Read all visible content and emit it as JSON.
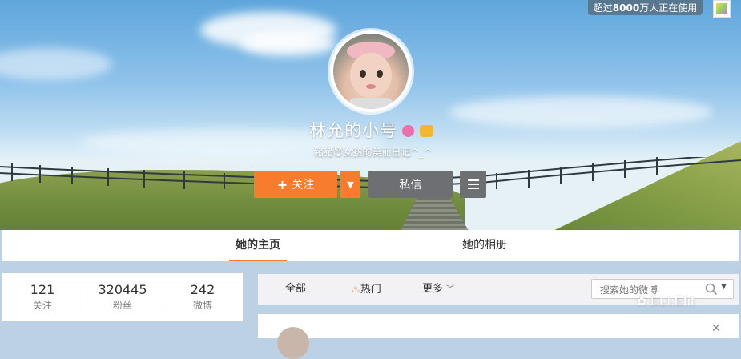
{
  "top_badge": {
    "prefix": "超过",
    "count": "8000",
    "suffix": "万人正在使用"
  },
  "profile": {
    "name": "林允的小号",
    "bio": "猪猪😈女孩的美丽日记^_^"
  },
  "actions": {
    "follow_label": "关注",
    "message_label": "私信"
  },
  "tabs": [
    {
      "label": "她的主页",
      "active": true
    },
    {
      "label": "她的相册",
      "active": false
    }
  ],
  "stats": [
    {
      "value": "121",
      "label": "关注"
    },
    {
      "value": "320445",
      "label": "粉丝"
    },
    {
      "value": "242",
      "label": "微博"
    }
  ],
  "feed_filters": {
    "all": "全部",
    "hot": "热门",
    "more": "更多"
  },
  "search": {
    "placeholder": "搜索她的微博"
  },
  "watermark": "ELLEfit",
  "colors": {
    "accent": "#f77c2e",
    "secondary_button": "#6d6f73"
  },
  "icons": [
    "plus-icon",
    "caret-down-icon",
    "menu-icon",
    "fire-icon",
    "chevron-down-icon",
    "search-icon",
    "verified-icon",
    "vip-icon",
    "wechat-icon"
  ]
}
